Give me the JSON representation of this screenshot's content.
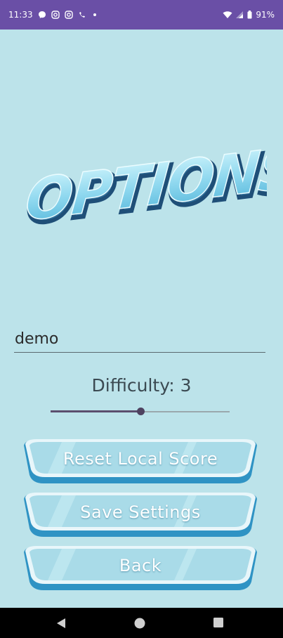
{
  "status_bar": {
    "time": "11:33",
    "battery": "91%",
    "icons": [
      "messenger-icon",
      "instagram-icon",
      "instagram-icon",
      "wifi-calling-icon",
      "dot-icon"
    ]
  },
  "title": "OPTIONS",
  "name_field": {
    "value": "demo"
  },
  "difficulty": {
    "label": "Difficulty: 3",
    "level": 3,
    "fraction": 0.5
  },
  "buttons": {
    "reset": "Reset Local Score",
    "save": "Save Settings",
    "back": "Back"
  },
  "colors": {
    "background": "#bce3ea",
    "status_bar": "#6a4fa6",
    "accent": "#5b4e6e"
  },
  "nav_icons": [
    "back-icon",
    "home-icon",
    "recents-icon"
  ]
}
